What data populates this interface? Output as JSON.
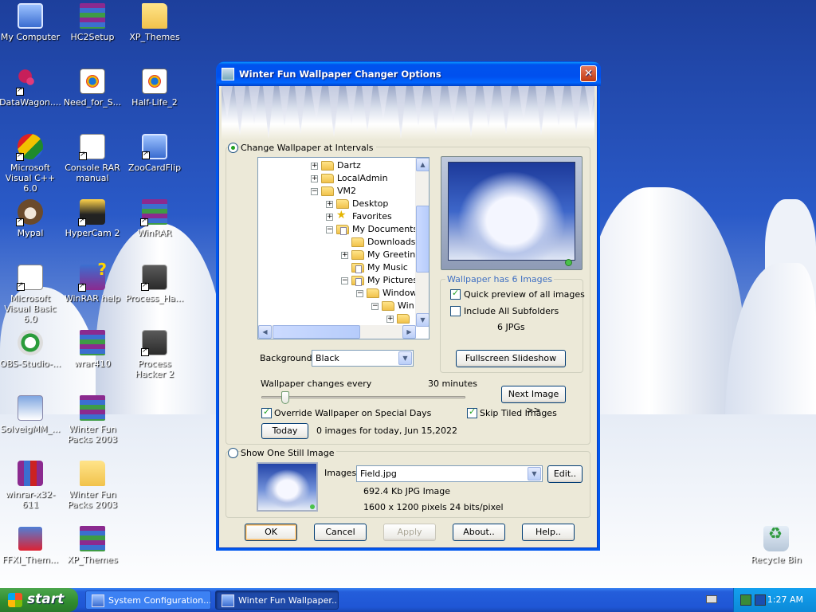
{
  "desktop": {
    "icons": [
      {
        "label": "My Computer",
        "icon": "computer-icon"
      },
      {
        "label": "HC2Setup",
        "icon": "winrar-archive-icon"
      },
      {
        "label": "XP_Themes",
        "icon": "folder-icon"
      },
      {
        "label": "DataWagon....",
        "icon": "flower-icon"
      },
      {
        "label": "Need_for_S...",
        "icon": "media-file-icon"
      },
      {
        "label": "Half-Life_2",
        "icon": "media-file-icon"
      },
      {
        "label": "Microsoft Visual C++ 6.0",
        "icon": "visual-cpp-icon"
      },
      {
        "label": "Console RAR manual",
        "icon": "document-icon"
      },
      {
        "label": "ZooCardFlip",
        "icon": "app-icon"
      },
      {
        "label": "Mypal",
        "icon": "raccoon-icon"
      },
      {
        "label": "HyperCam 2",
        "icon": "camera-icon"
      },
      {
        "label": "WinRAR",
        "icon": "winrar-icon"
      },
      {
        "label": "Microsoft Visual Basic 6.0",
        "icon": "visual-basic-icon"
      },
      {
        "label": "WinRAR help",
        "icon": "help-icon"
      },
      {
        "label": "Process_Ha...",
        "icon": "process-hacker-icon"
      },
      {
        "label": "OBS-Studio-...",
        "icon": "obs-icon"
      },
      {
        "label": "wrar410",
        "icon": "winrar-installer-icon"
      },
      {
        "label": "Process Hacker 2",
        "icon": "process-hacker-icon"
      },
      {
        "label": "SolveigMM_...",
        "icon": "installer-icon"
      },
      {
        "label": "Winter Fun Packs 2003",
        "icon": "winrar-archive-icon"
      },
      {
        "label": "winrar-x32-611",
        "icon": "winrar-installer-icon"
      },
      {
        "label": "Winter Fun Packs 2003",
        "icon": "folder-icon"
      },
      {
        "label": "FFXI_Them...",
        "icon": "installer-icon"
      },
      {
        "label": "XP_Themes",
        "icon": "winrar-archive-icon"
      },
      {
        "label": "Recycle Bin",
        "icon": "recycle-bin-icon"
      }
    ]
  },
  "taskbar": {
    "start_label": "start",
    "tasks": [
      {
        "label": "System Configuration..."
      },
      {
        "label": "Winter Fun Wallpaper..."
      }
    ],
    "clock": "1:27 AM"
  },
  "dialog": {
    "title": "Winter Fun Wallpaper Changer Options",
    "close_label": "✕",
    "interval_radio_label": "Change Wallpaper at Intervals",
    "still_radio_label": "Show One Still Image",
    "tree": [
      {
        "label": "Dartz",
        "expander": "+"
      },
      {
        "label": "LocalAdmin",
        "expander": "+"
      },
      {
        "label": "VM2",
        "expander": "−"
      },
      {
        "label": "Desktop",
        "expander": "+"
      },
      {
        "label": "Favorites",
        "expander": "+"
      },
      {
        "label": "My Documents",
        "expander": "−"
      },
      {
        "label": "Downloads",
        "expander": ""
      },
      {
        "label": "My Greeting",
        "expander": "+"
      },
      {
        "label": "My Music",
        "expander": ""
      },
      {
        "label": "My Pictures",
        "expander": "−"
      },
      {
        "label": "Window",
        "expander": "−"
      },
      {
        "label": "Win",
        "expander": "−"
      },
      {
        "label": "",
        "expander": "+"
      }
    ],
    "background_label": "Background",
    "background_value": "Black",
    "wallpaper_count_label": "Wallpaper has 6 Images",
    "quick_preview_label": "Quick preview of all images",
    "include_subfolders_label": "Include All Subfolders",
    "jpg_count": "6 JPGs",
    "fullscreen_button": "Fullscreen Slideshow",
    "interval_label": "Wallpaper changes every",
    "interval_value": "30 minutes",
    "interval_slider_fraction": 0.1,
    "next_image_button": "Next Image >>",
    "override_label": "Override Wallpaper on Special Days",
    "skip_tiled_label": "Skip Tiled Images",
    "today_button": "Today",
    "today_info": "0 images for today, Jun 15,2022",
    "images_label": "Images:",
    "image_file": "Field.jpg",
    "edit_button": "Edit..",
    "file_info": "692.4 Kb  JPG Image",
    "dimensions_info": "1600 x 1200 pixels  24 bits/pixel",
    "ok_button": "OK",
    "cancel_button": "Cancel",
    "apply_button": "Apply",
    "about_button": "About..",
    "help_button": "Help.."
  },
  "colors": {
    "titlebar": "#0053ee",
    "dialog_bg": "#ece9d8",
    "accent_group_label": "#3f6fc2"
  }
}
